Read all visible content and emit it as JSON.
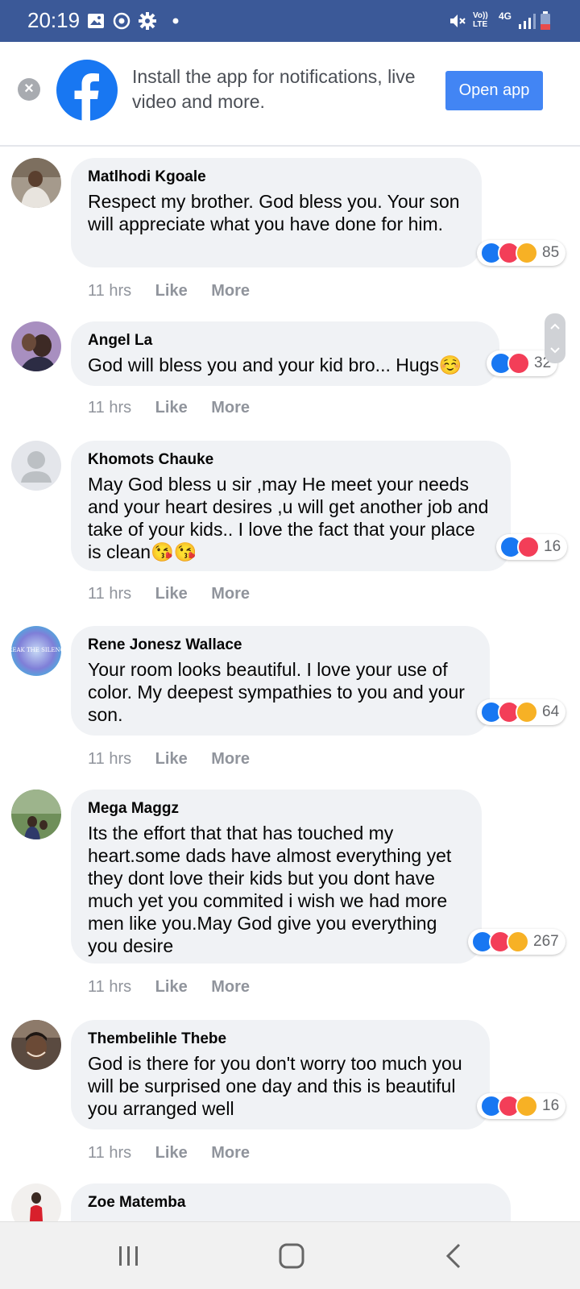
{
  "status_bar": {
    "time": "20:19",
    "left_icons": [
      "image-icon",
      "sync-icon",
      "gear-icon",
      "dot-icon"
    ],
    "right_icons": [
      "mute-icon",
      "volte-icon",
      "4g-icon",
      "signal-icon",
      "battery-icon"
    ],
    "volte_label": "Vo)) LTE",
    "network_label": "4G",
    "color": "#3b5998"
  },
  "banner": {
    "text": "Install the app for notifications, live video and more.",
    "button_label": "Open app",
    "close_label": "×",
    "button_color": "#4285f4"
  },
  "comments": [
    {
      "author": "Matlhodi Kgoale",
      "text": "Respect my brother. God bless you. Your son will appreciate what you have done for him.",
      "time": "11 hrs",
      "like": "Like",
      "more": "More",
      "reactions": [
        "like",
        "love",
        "care"
      ],
      "count": "85"
    },
    {
      "author": "Angel La",
      "text": "God will bless you and your kid bro... Hugs☺️",
      "time": "11 hrs",
      "like": "Like",
      "more": "More",
      "reactions": [
        "like",
        "love"
      ],
      "count": "32"
    },
    {
      "author": "Khomots Chauke",
      "text": "May God bless u sir ,may He meet your needs and your heart desires ,u will get another job and take of your kids.. I love the fact that your place is clean😘😘",
      "time": "11 hrs",
      "like": "Like",
      "more": "More",
      "reactions": [
        "like",
        "love"
      ],
      "count": "16"
    },
    {
      "author": "Rene Jonesz Wallace",
      "text": "Your room looks beautiful. I love your use of color. My deepest sympathies to you and your son.",
      "time": "11 hrs",
      "like": "Like",
      "more": "More",
      "reactions": [
        "like",
        "love",
        "care"
      ],
      "count": "64",
      "avatar_text": "BREAK THE SILENCE"
    },
    {
      "author": "Mega Maggz",
      "text": "Its the effort that that has touched my heart.some dads have almost everything yet they dont love their kids but you dont have much yet you commited i wish we had more men like you.May God give you everything you desire",
      "time": "11 hrs",
      "like": "Like",
      "more": "More",
      "reactions": [
        "like",
        "love",
        "care"
      ],
      "count": "267"
    },
    {
      "author": "Thembelihle Thebe",
      "text": "God is there for you don't worry too much you will be surprised one day and this is beautiful you arranged well",
      "time": "11 hrs",
      "like": "Like",
      "more": "More",
      "reactions": [
        "like",
        "love",
        "care"
      ],
      "count": "16"
    },
    {
      "author": "Zoe Matemba",
      "text": ""
    }
  ],
  "nav_bar": {
    "buttons": [
      "recent-apps-icon",
      "home-icon",
      "back-icon"
    ]
  }
}
